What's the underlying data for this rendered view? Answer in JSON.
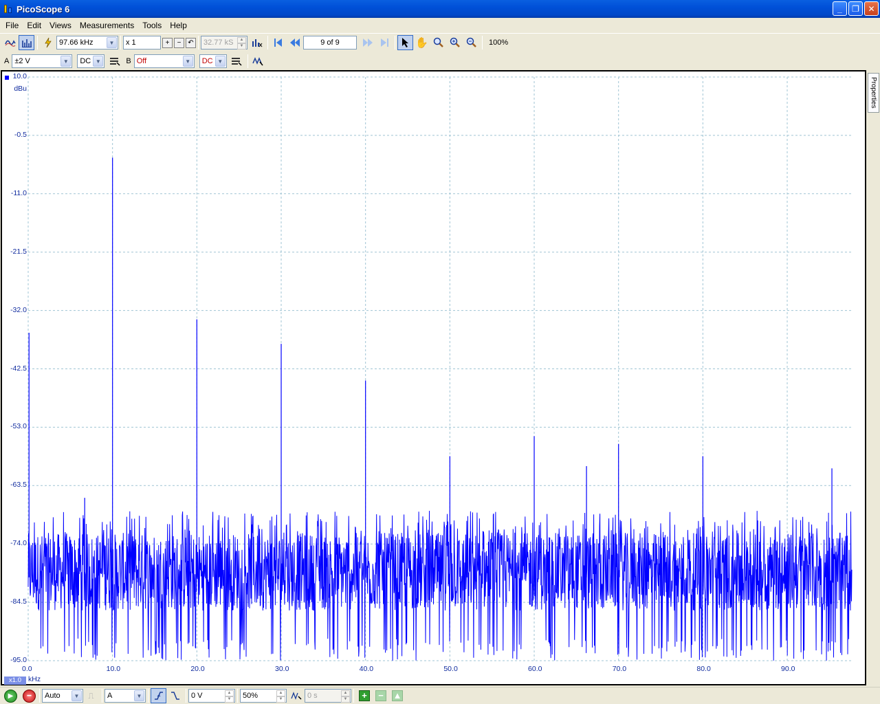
{
  "window": {
    "title": "PicoScope 6"
  },
  "menu": [
    {
      "label": "File"
    },
    {
      "label": "Edit"
    },
    {
      "label": "Views"
    },
    {
      "label": "Measurements"
    },
    {
      "label": "Tools"
    },
    {
      "label": "Help"
    }
  ],
  "toolbar": {
    "timebase": "97.66 kHz",
    "zoom_factor": "x 1",
    "samples": "32.77 kS",
    "buffer_nav": "9 of 9",
    "zoom_level": "100%"
  },
  "channels": {
    "a": {
      "label": "A",
      "range": "±2 V",
      "coupling": "DC"
    },
    "b": {
      "label": "B",
      "range": "Off",
      "coupling": "DC"
    }
  },
  "side_tab": "Properties",
  "bottom": {
    "trigger_mode": "Auto",
    "trigger_source": "A",
    "threshold": "0 V",
    "pre_trigger": "50%",
    "delay": "0 s"
  },
  "chart_data": {
    "type": "line",
    "title": "",
    "ylabel": "dBu",
    "xlabel": "kHz",
    "x_scale_badge": "x1.0",
    "ylim": [
      -95.0,
      10.0
    ],
    "xlim": [
      0,
      97.66
    ],
    "y_ticks": [
      "10.0",
      "-0.5",
      "-11.0",
      "-21.5",
      "-32.0",
      "-42.5",
      "-53.0",
      "-63.5",
      "-74.0",
      "-84.5",
      "-95.0"
    ],
    "x_ticks": [
      "0.0",
      "10.0",
      "20.0",
      "30.0",
      "40.0",
      "50.0",
      "60.0",
      "70.0",
      "80.0",
      "90.0"
    ],
    "grid": true,
    "series_color": "#0000ff",
    "noise_floor_db": [
      -95,
      -68
    ],
    "peaks": [
      {
        "freq_khz": 0.1,
        "db": -36
      },
      {
        "freq_khz": 10.0,
        "db": -4.5
      },
      {
        "freq_khz": 20.0,
        "db": -33.6
      },
      {
        "freq_khz": 30.0,
        "db": -38
      },
      {
        "freq_khz": 40.0,
        "db": -44.6
      },
      {
        "freq_khz": 50.0,
        "db": -58.2
      },
      {
        "freq_khz": 60.0,
        "db": -54.6
      },
      {
        "freq_khz": 66.2,
        "db": -60
      },
      {
        "freq_khz": 70.0,
        "db": -56
      },
      {
        "freq_khz": 80.0,
        "db": -58.2
      },
      {
        "freq_khz": 95.3,
        "db": -60.4
      },
      {
        "freq_khz": 6.7,
        "db": -65.7
      }
    ]
  }
}
